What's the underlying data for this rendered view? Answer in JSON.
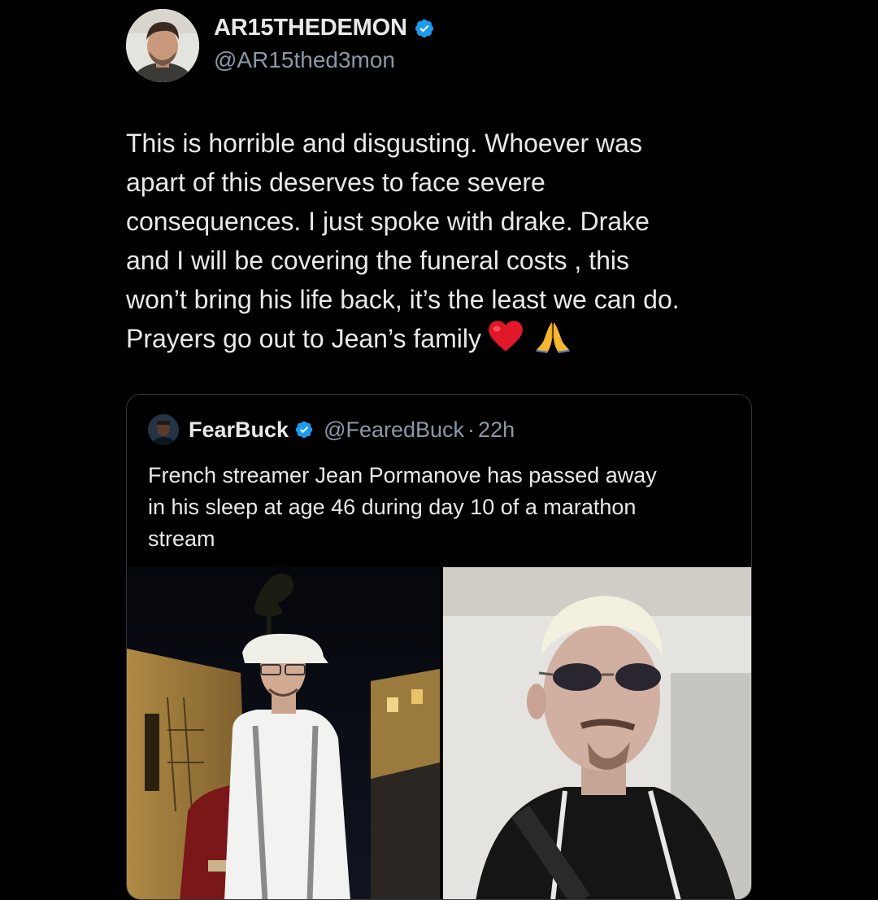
{
  "tweet": {
    "display_name": "AR15THEDEMON",
    "handle": "@AR15thed3mon",
    "verified": true,
    "avatar_icon": "user-avatar",
    "text_lines": [
      "This is horrible and disgusting. Whoever was",
      "apart of this deserves to face severe",
      "consequences. I just spoke with drake. Drake",
      "and I will be covering the funeral costs , this",
      "won’t bring his life back, it’s the least we can do.",
      "Prayers go out to Jean’s family"
    ],
    "emojis": [
      "red-heart-emoji",
      "folded-hands-emoji"
    ]
  },
  "quote": {
    "display_name": "FearBuck",
    "handle": "@FearedBuck",
    "separator": "·",
    "time": "22h",
    "verified": true,
    "text_lines": [
      "French streamer Jean Pormanove has passed away",
      "in his sleep at age 46 during day 10 of a marathon",
      "stream"
    ],
    "media": [
      "photo-man-night-street",
      "photo-man-sunglasses"
    ]
  },
  "colors": {
    "background": "#000000",
    "text": "#e7e9ea",
    "secondary_text": "#8b98a5",
    "verified_blue": "#1d9bf0",
    "card_border": "#333639"
  }
}
